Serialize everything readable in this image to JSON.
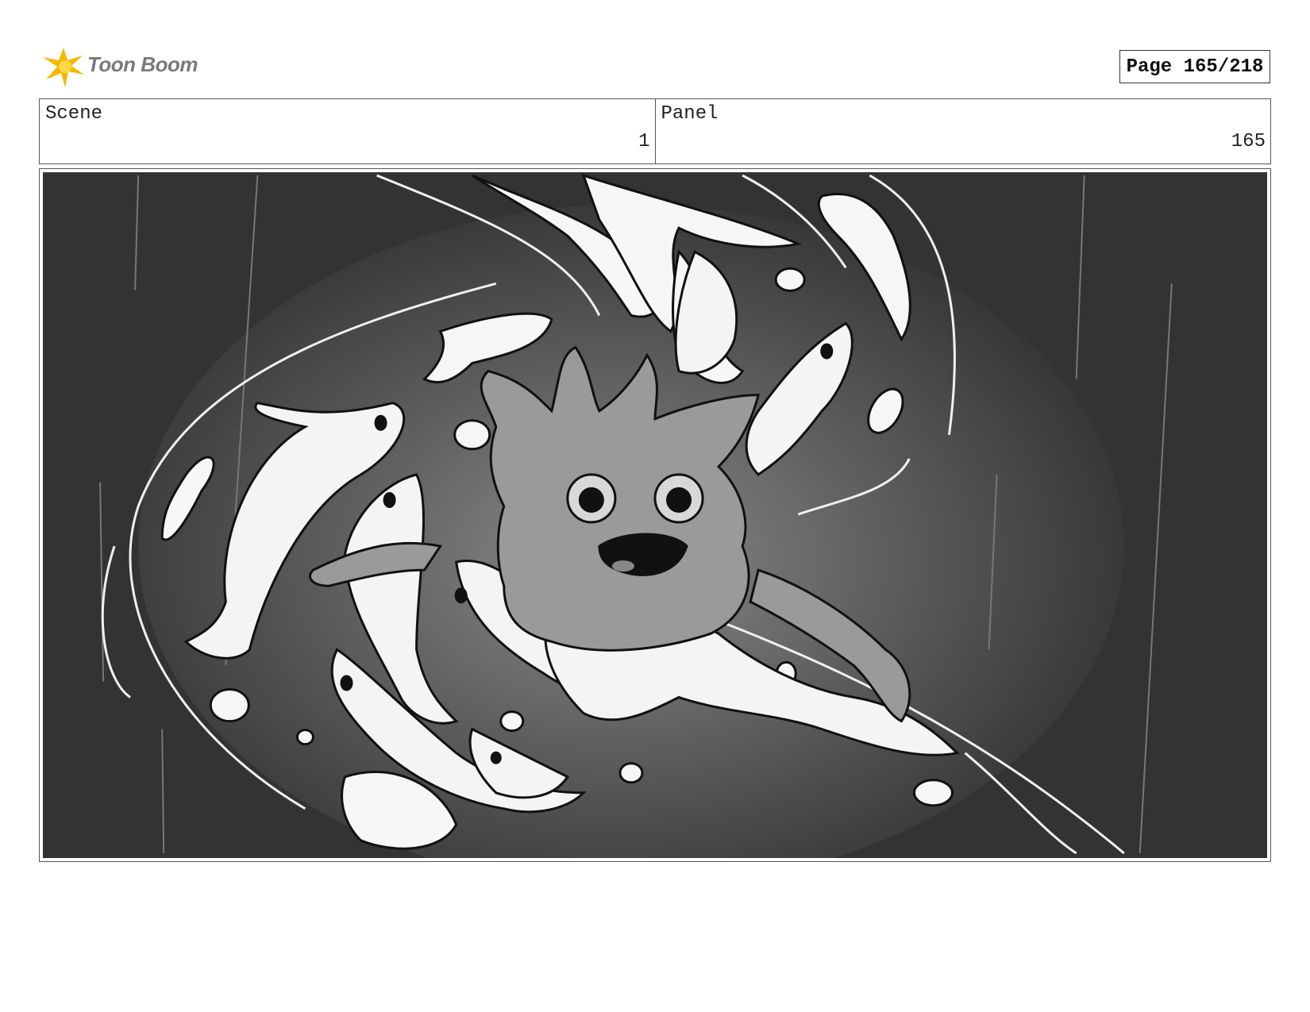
{
  "header": {
    "logo_text": "Toon Boom",
    "logo_icon": "starburst-logo-icon",
    "page_label": "Page 165/218"
  },
  "info": {
    "scene_label": "Scene",
    "scene_value": "1",
    "panel_label": "Panel",
    "panel_value": "165"
  },
  "colors": {
    "logo_yellow": "#f5b800",
    "panel_dark": "#3a3a3a",
    "character_gray": "#9a9a9a",
    "fish_white": "#f4f4f4"
  }
}
